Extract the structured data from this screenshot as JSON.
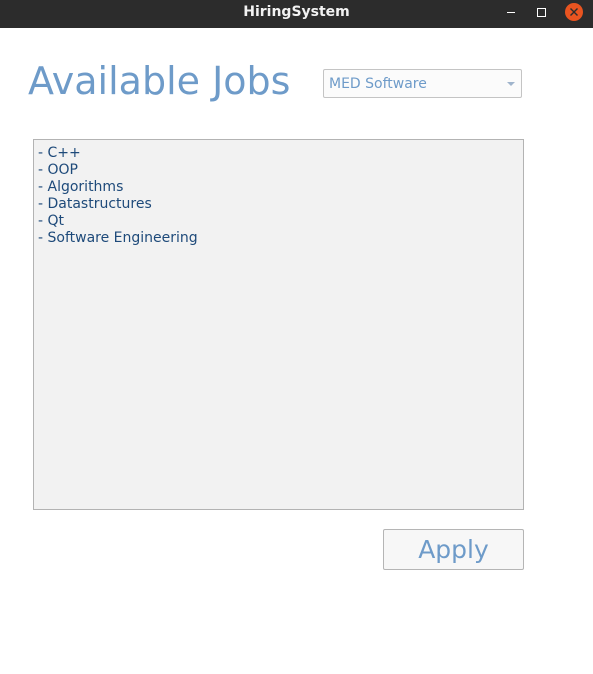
{
  "window": {
    "title": "HiringSystem",
    "controls": {
      "minimize_icon": "minimize-icon",
      "maximize_icon": "maximize-icon",
      "close_icon": "close-icon",
      "close_color": "#e95420"
    }
  },
  "main": {
    "heading": "Available Jobs",
    "job_selector": {
      "selected_value": "MED Software"
    },
    "job_requirements": [
      "- C++",
      "- OOP",
      "- Algorithms",
      "- Datastructures",
      "- Qt",
      "- Software Engineering"
    ],
    "apply_label": "Apply"
  },
  "colors": {
    "accent_text": "#6e9bc9",
    "list_text": "#1e4a7a",
    "titlebar": "#2c2c2c"
  }
}
